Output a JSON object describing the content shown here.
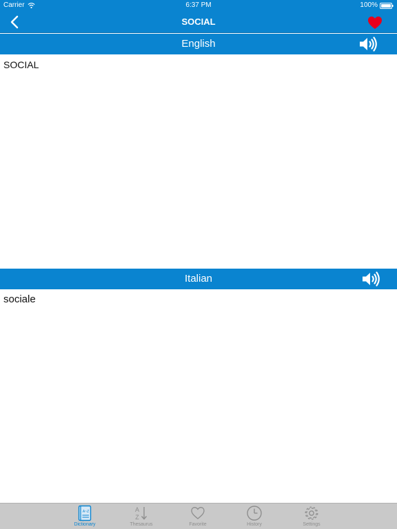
{
  "status_bar": {
    "carrier": "Carrier",
    "time": "6:37 PM",
    "battery": "100%"
  },
  "nav": {
    "title": "SOCIAL",
    "back_icon": "chevron-left-icon",
    "favorite_icon": "heart-icon",
    "favorite_color": "#e8001c"
  },
  "source": {
    "language": "English",
    "text": "SOCIAL",
    "speaker_icon": "speaker-icon"
  },
  "target": {
    "language": "Italian",
    "text": "sociale",
    "speaker_icon": "speaker-icon"
  },
  "tabs": [
    {
      "label": "Dictionary",
      "icon": "dictionary-icon",
      "active": true
    },
    {
      "label": "Thesaurus",
      "icon": "sort-az-icon",
      "active": false
    },
    {
      "label": "Favorite",
      "icon": "heart-outline-icon",
      "active": false
    },
    {
      "label": "History",
      "icon": "clock-icon",
      "active": false
    },
    {
      "label": "Settings",
      "icon": "gear-icon",
      "active": false
    }
  ],
  "colors": {
    "accent": "#0a84d0",
    "tab_inactive": "#8e8e8e",
    "tabbar_bg": "#c9c9c9"
  }
}
